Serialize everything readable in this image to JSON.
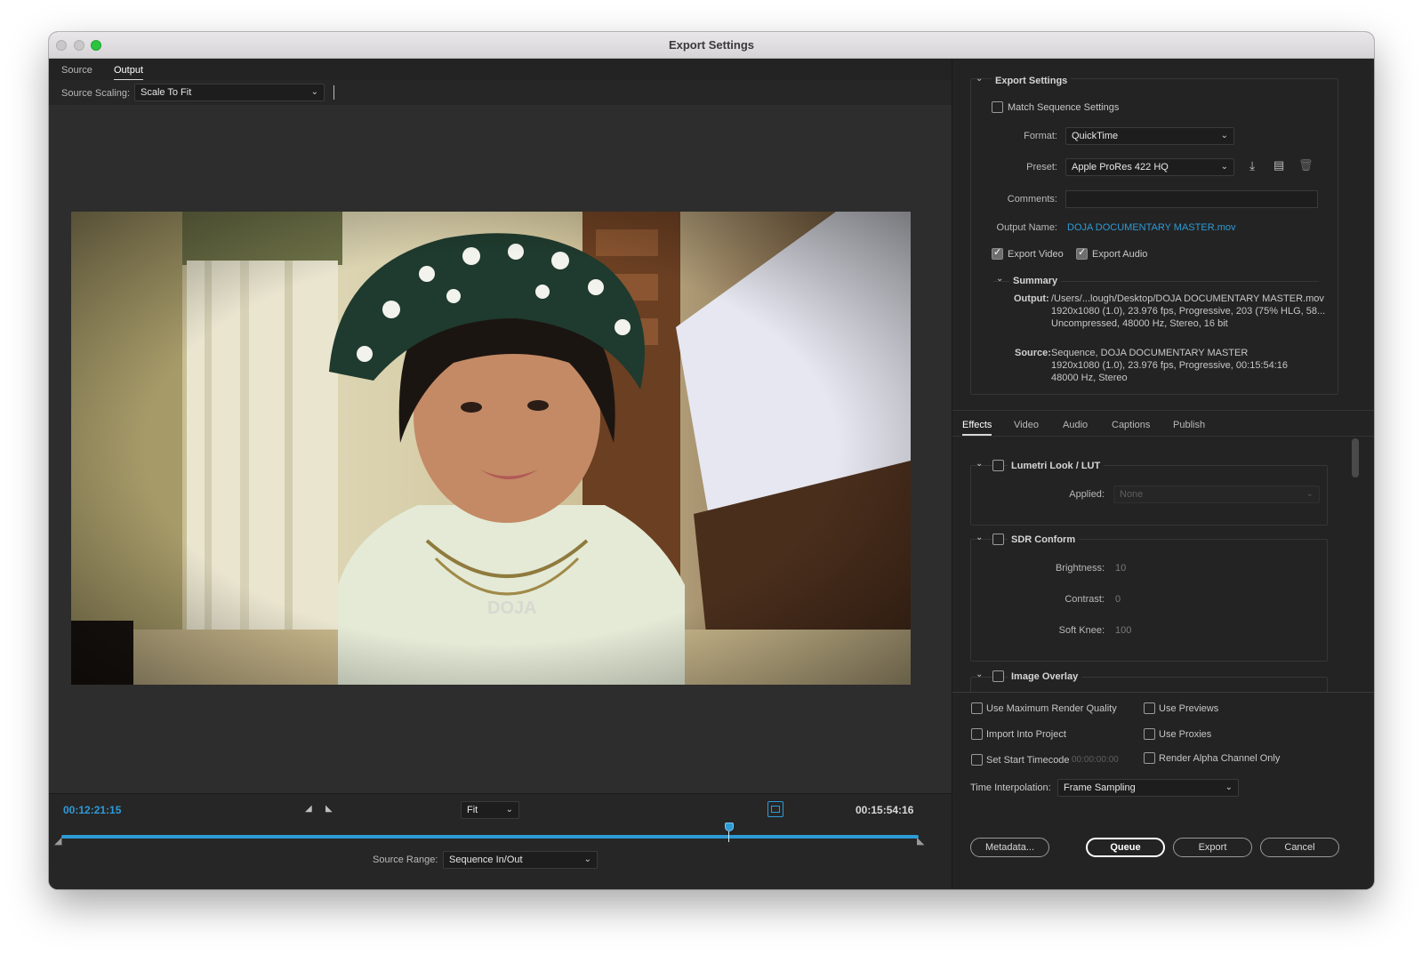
{
  "window": {
    "title": "Export Settings"
  },
  "left": {
    "tabs": [
      "Source",
      "Output"
    ],
    "active_tab": "Output",
    "source_scaling_label": "Source Scaling:",
    "source_scaling_value": "Scale To Fit",
    "timecode_current": "00:12:21:15",
    "timecode_end": "00:15:54:16",
    "zoom_value": "Fit",
    "source_range_label": "Source Range:",
    "source_range_value": "Sequence In/Out",
    "playhead_fraction": 0.779,
    "preview_text": "DOJA"
  },
  "export_settings": {
    "section_title": "Export Settings",
    "match_sequence_label": "Match Sequence Settings",
    "match_sequence_checked": false,
    "format_label": "Format:",
    "format_value": "QuickTime",
    "preset_label": "Preset:",
    "preset_value": "Apple ProRes 422 HQ",
    "comments_label": "Comments:",
    "comments_value": "",
    "output_name_label": "Output Name:",
    "output_name_value": "DOJA DOCUMENTARY MASTER.mov",
    "export_video_label": "Export Video",
    "export_video_checked": true,
    "export_audio_label": "Export Audio",
    "export_audio_checked": true,
    "summary_title": "Summary",
    "output_key": "Output:",
    "output_lines": [
      "/Users/...lough/Desktop/DOJA DOCUMENTARY MASTER.mov",
      "1920x1080 (1.0), 23.976 fps, Progressive, 203 (75% HLG, 58...",
      "Uncompressed, 48000 Hz, Stereo, 16 bit"
    ],
    "source_key": "Source:",
    "source_lines": [
      "Sequence, DOJA DOCUMENTARY MASTER",
      "1920x1080 (1.0), 23.976 fps, Progressive, 00:15:54:16",
      "48000 Hz, Stereo"
    ]
  },
  "settings_tabs": [
    "Effects",
    "Video",
    "Audio",
    "Captions",
    "Publish"
  ],
  "settings_active_tab": "Effects",
  "effects": {
    "lumetri_title": "Lumetri Look / LUT",
    "lumetri_applied_label": "Applied:",
    "lumetri_applied_value": "None",
    "sdr_title": "SDR Conform",
    "brightness_label": "Brightness:",
    "brightness_value": "10",
    "contrast_label": "Contrast:",
    "contrast_value": "0",
    "soft_knee_label": "Soft Knee:",
    "soft_knee_value": "100",
    "image_overlay_title": "Image Overlay"
  },
  "options": {
    "max_render_quality": "Use Maximum Render Quality",
    "use_previews": "Use Previews",
    "import_into_project": "Import Into Project",
    "use_proxies": "Use Proxies",
    "set_start_timecode": "Set Start Timecode",
    "start_timecode_value": "00:00:00:00",
    "render_alpha_only": "Render Alpha Channel Only",
    "time_interpolation_label": "Time Interpolation:",
    "time_interpolation_value": "Frame Sampling"
  },
  "buttons": {
    "metadata": "Metadata...",
    "queue": "Queue",
    "export": "Export",
    "cancel": "Cancel"
  },
  "colors": {
    "accent_blue": "#2d9bd6",
    "panel_dark": "#232323",
    "panel_mid": "#2d2d2d"
  }
}
